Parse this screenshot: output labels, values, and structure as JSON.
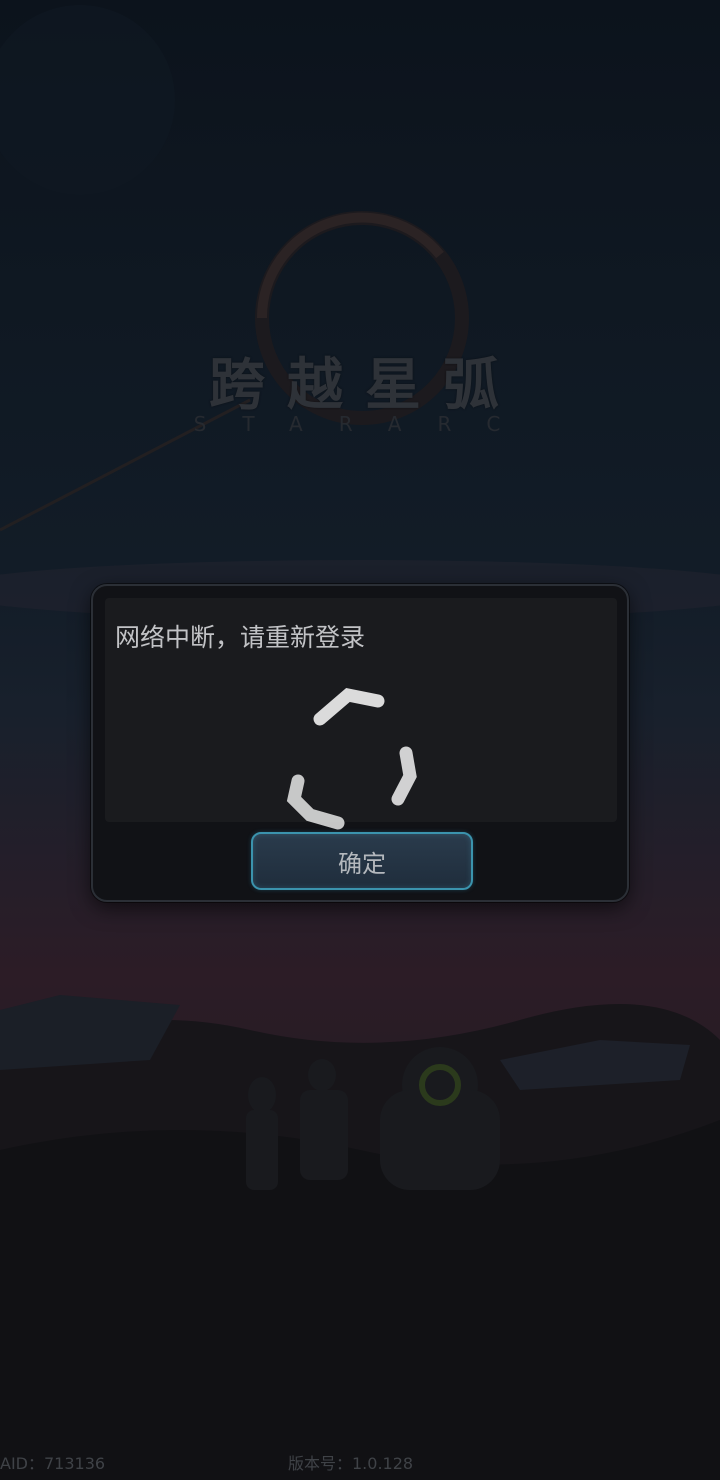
{
  "logo": {
    "title": "跨越星弧",
    "subtitle": "STARARC"
  },
  "dialog": {
    "message": "网络中断，请重新登录",
    "confirm_label": "确定"
  },
  "loading": {
    "icon": "loading-spinner-icon"
  },
  "footer": {
    "aid": "AID：713136",
    "version": "版本号：1.0.128"
  },
  "colors": {
    "button_border": "#3b93ad",
    "dialog_background": "#111216",
    "message_text": "#c2c3c6"
  }
}
